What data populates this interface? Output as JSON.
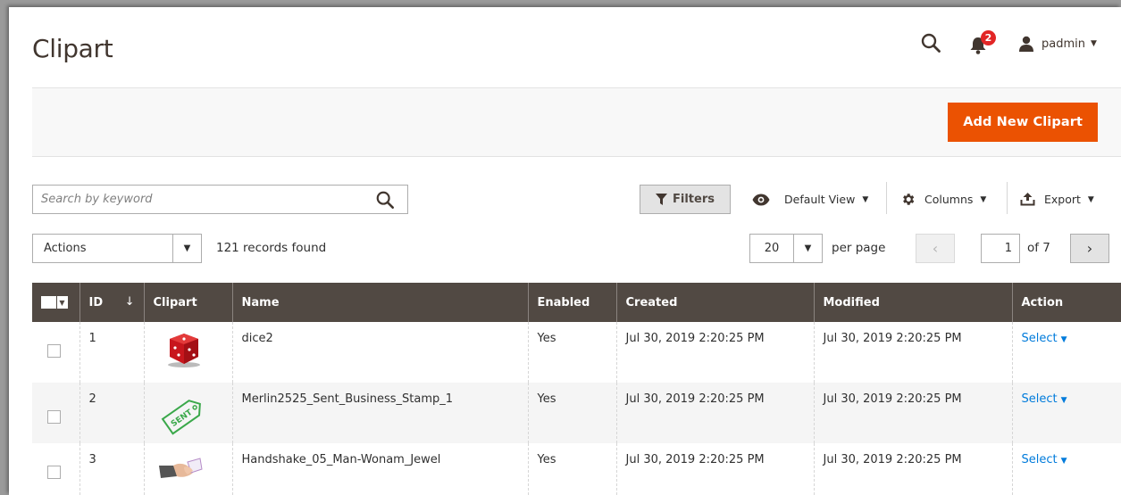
{
  "header": {
    "title": "Clipart",
    "notification_count": "2",
    "username": "padmin"
  },
  "action_bar": {
    "add_button": "Add New Clipart"
  },
  "toolbar": {
    "search_placeholder": "Search by keyword",
    "filters_label": "Filters",
    "view_label": "Default View",
    "columns_label": "Columns",
    "export_label": "Export",
    "actions_label": "Actions",
    "records_found": "121 records found",
    "per_page_value": "20",
    "per_page_label": "per page",
    "current_page": "1",
    "of_pages": "of 7"
  },
  "grid": {
    "columns": [
      "ID",
      "Clipart",
      "Name",
      "Enabled",
      "Created",
      "Modified",
      "Action"
    ],
    "rows": [
      {
        "id": "1",
        "clipart": "dice",
        "name": "dice2",
        "enabled": "Yes",
        "created": "Jul 30, 2019 2:20:25 PM",
        "modified": "Jul 30, 2019 2:20:25 PM",
        "action": "Select"
      },
      {
        "id": "2",
        "clipart": "sent-stamp",
        "name": "Merlin2525_Sent_Business_Stamp_1",
        "enabled": "Yes",
        "created": "Jul 30, 2019 2:20:25 PM",
        "modified": "Jul 30, 2019 2:20:25 PM",
        "action": "Select"
      },
      {
        "id": "3",
        "clipart": "handshake",
        "name": "Handshake_05_Man-Wonam_Jewel",
        "enabled": "Yes",
        "created": "Jul 30, 2019 2:20:25 PM",
        "modified": "Jul 30, 2019 2:20:25 PM",
        "action": "Select"
      }
    ]
  },
  "colors": {
    "accent": "#eb5202",
    "grid_header": "#514943",
    "link": "#007bdb"
  }
}
